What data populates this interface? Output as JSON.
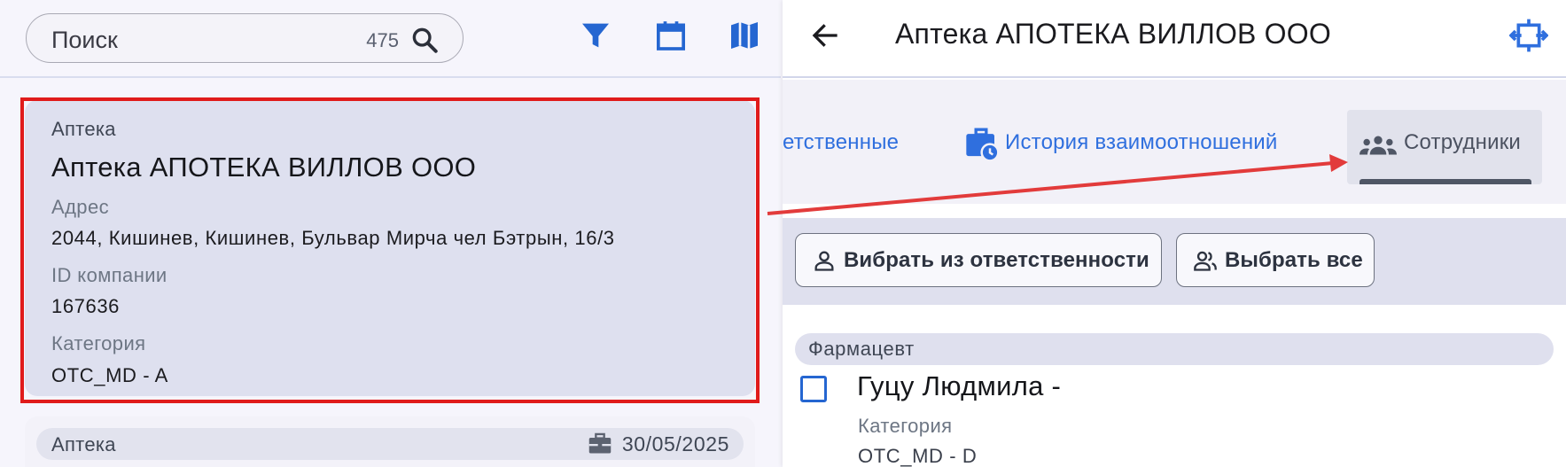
{
  "left": {
    "search": {
      "placeholder": "Поиск",
      "count": "475"
    },
    "icons": {
      "search": "search-icon",
      "filter": "filter-icon",
      "calendar": "calendar-icon",
      "map": "map-icon"
    },
    "cards": [
      {
        "type": "Аптека",
        "name": "Аптека АПОТЕКА ВИЛЛОВ ООО",
        "address_label": "Адрес",
        "address": "2044, Кишинев, Кишинев, Бульвар Мирча чел Бэтрын, 16/3",
        "id_label": "ID компании",
        "id": "167636",
        "category_label": "Категория",
        "category": "OTC_MD - A"
      },
      {
        "type": "Аптека",
        "date": "30/05/2025"
      }
    ]
  },
  "right": {
    "title": "Аптека АПОТЕКА ВИЛЛОВ ООО",
    "tabs": [
      {
        "label": "етственные"
      },
      {
        "label": "История взаимоотношений"
      },
      {
        "label": "Сотрудники",
        "active": true
      }
    ],
    "actions": {
      "select_from_responsibility": "Вибрать из ответственности",
      "select_all": "Выбрать все"
    },
    "section": "Фармацевт",
    "employee": {
      "name": "Гуцу Людмила -",
      "category_label": "Категория",
      "category": "OTC_MD - D"
    }
  },
  "colors": {
    "accent": "#2f6fde",
    "icon_blue": "#2566d1",
    "highlight": "#e01b1b",
    "card_bg": "#dee0ef"
  }
}
